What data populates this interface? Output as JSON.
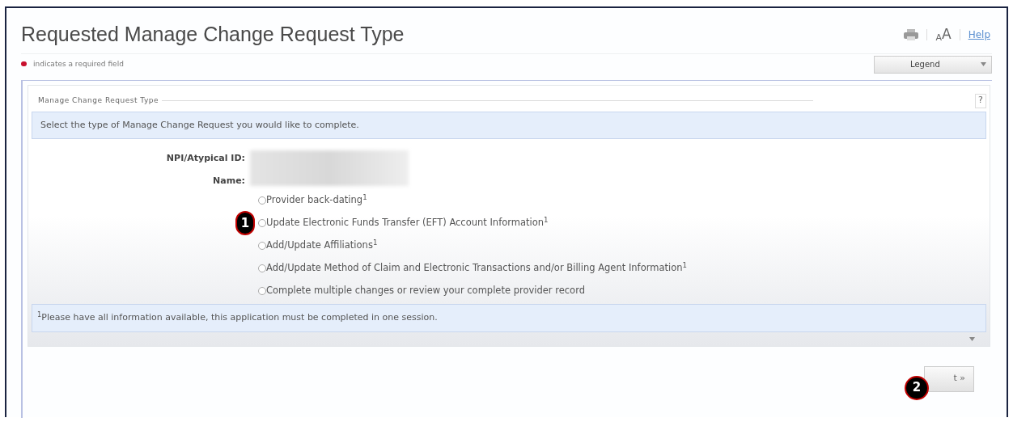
{
  "page": {
    "title": "Requested Manage Change Request Type",
    "required_note": "indicates a required field",
    "help_link": "Help",
    "font_size_label": "A",
    "font_size_label_large": "A",
    "legend_button": "Legend"
  },
  "section": {
    "legend": "Manage Change Request Type",
    "help_button": "?",
    "instruction": "Select the type of Manage Change Request you would like to complete.",
    "fields": [
      {
        "label": "NPI/Atypical ID:"
      },
      {
        "label": "Name:"
      }
    ],
    "options": [
      {
        "label": "Provider back-dating$^{1}$",
        "selected": false
      },
      {
        "label": "Update Electronic Funds Transfer (EFT) Account Information$^{1}$",
        "selected": false,
        "callout": "1"
      },
      {
        "label": "Add/Update Affiliations$^{1}$",
        "selected": false
      },
      {
        "label": "Add/Update Method of Claim and Electronic Transactions and/or Billing Agent Information$^{1}$",
        "selected": false
      },
      {
        "label": "Complete multiple changes or review your complete provider record",
        "selected": false
      }
    ],
    "footnote": "$^{1}$Please have all information available, this application must be completed in one session."
  },
  "next_button": {
    "label": "t »",
    "callout": "2"
  }
}
